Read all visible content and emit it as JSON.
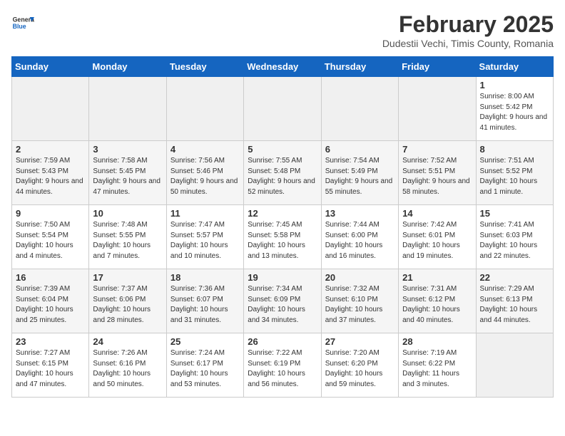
{
  "header": {
    "logo_general": "General",
    "logo_blue": "Blue",
    "title": "February 2025",
    "subtitle": "Dudestii Vechi, Timis County, Romania"
  },
  "weekdays": [
    "Sunday",
    "Monday",
    "Tuesday",
    "Wednesday",
    "Thursday",
    "Friday",
    "Saturday"
  ],
  "weeks": [
    [
      {
        "day": "",
        "info": ""
      },
      {
        "day": "",
        "info": ""
      },
      {
        "day": "",
        "info": ""
      },
      {
        "day": "",
        "info": ""
      },
      {
        "day": "",
        "info": ""
      },
      {
        "day": "",
        "info": ""
      },
      {
        "day": "1",
        "info": "Sunrise: 8:00 AM\nSunset: 5:42 PM\nDaylight: 9 hours and 41 minutes."
      }
    ],
    [
      {
        "day": "2",
        "info": "Sunrise: 7:59 AM\nSunset: 5:43 PM\nDaylight: 9 hours and 44 minutes."
      },
      {
        "day": "3",
        "info": "Sunrise: 7:58 AM\nSunset: 5:45 PM\nDaylight: 9 hours and 47 minutes."
      },
      {
        "day": "4",
        "info": "Sunrise: 7:56 AM\nSunset: 5:46 PM\nDaylight: 9 hours and 50 minutes."
      },
      {
        "day": "5",
        "info": "Sunrise: 7:55 AM\nSunset: 5:48 PM\nDaylight: 9 hours and 52 minutes."
      },
      {
        "day": "6",
        "info": "Sunrise: 7:54 AM\nSunset: 5:49 PM\nDaylight: 9 hours and 55 minutes."
      },
      {
        "day": "7",
        "info": "Sunrise: 7:52 AM\nSunset: 5:51 PM\nDaylight: 9 hours and 58 minutes."
      },
      {
        "day": "8",
        "info": "Sunrise: 7:51 AM\nSunset: 5:52 PM\nDaylight: 10 hours and 1 minute."
      }
    ],
    [
      {
        "day": "9",
        "info": "Sunrise: 7:50 AM\nSunset: 5:54 PM\nDaylight: 10 hours and 4 minutes."
      },
      {
        "day": "10",
        "info": "Sunrise: 7:48 AM\nSunset: 5:55 PM\nDaylight: 10 hours and 7 minutes."
      },
      {
        "day": "11",
        "info": "Sunrise: 7:47 AM\nSunset: 5:57 PM\nDaylight: 10 hours and 10 minutes."
      },
      {
        "day": "12",
        "info": "Sunrise: 7:45 AM\nSunset: 5:58 PM\nDaylight: 10 hours and 13 minutes."
      },
      {
        "day": "13",
        "info": "Sunrise: 7:44 AM\nSunset: 6:00 PM\nDaylight: 10 hours and 16 minutes."
      },
      {
        "day": "14",
        "info": "Sunrise: 7:42 AM\nSunset: 6:01 PM\nDaylight: 10 hours and 19 minutes."
      },
      {
        "day": "15",
        "info": "Sunrise: 7:41 AM\nSunset: 6:03 PM\nDaylight: 10 hours and 22 minutes."
      }
    ],
    [
      {
        "day": "16",
        "info": "Sunrise: 7:39 AM\nSunset: 6:04 PM\nDaylight: 10 hours and 25 minutes."
      },
      {
        "day": "17",
        "info": "Sunrise: 7:37 AM\nSunset: 6:06 PM\nDaylight: 10 hours and 28 minutes."
      },
      {
        "day": "18",
        "info": "Sunrise: 7:36 AM\nSunset: 6:07 PM\nDaylight: 10 hours and 31 minutes."
      },
      {
        "day": "19",
        "info": "Sunrise: 7:34 AM\nSunset: 6:09 PM\nDaylight: 10 hours and 34 minutes."
      },
      {
        "day": "20",
        "info": "Sunrise: 7:32 AM\nSunset: 6:10 PM\nDaylight: 10 hours and 37 minutes."
      },
      {
        "day": "21",
        "info": "Sunrise: 7:31 AM\nSunset: 6:12 PM\nDaylight: 10 hours and 40 minutes."
      },
      {
        "day": "22",
        "info": "Sunrise: 7:29 AM\nSunset: 6:13 PM\nDaylight: 10 hours and 44 minutes."
      }
    ],
    [
      {
        "day": "23",
        "info": "Sunrise: 7:27 AM\nSunset: 6:15 PM\nDaylight: 10 hours and 47 minutes."
      },
      {
        "day": "24",
        "info": "Sunrise: 7:26 AM\nSunset: 6:16 PM\nDaylight: 10 hours and 50 minutes."
      },
      {
        "day": "25",
        "info": "Sunrise: 7:24 AM\nSunset: 6:17 PM\nDaylight: 10 hours and 53 minutes."
      },
      {
        "day": "26",
        "info": "Sunrise: 7:22 AM\nSunset: 6:19 PM\nDaylight: 10 hours and 56 minutes."
      },
      {
        "day": "27",
        "info": "Sunrise: 7:20 AM\nSunset: 6:20 PM\nDaylight: 10 hours and 59 minutes."
      },
      {
        "day": "28",
        "info": "Sunrise: 7:19 AM\nSunset: 6:22 PM\nDaylight: 11 hours and 3 minutes."
      },
      {
        "day": "",
        "info": ""
      }
    ]
  ]
}
